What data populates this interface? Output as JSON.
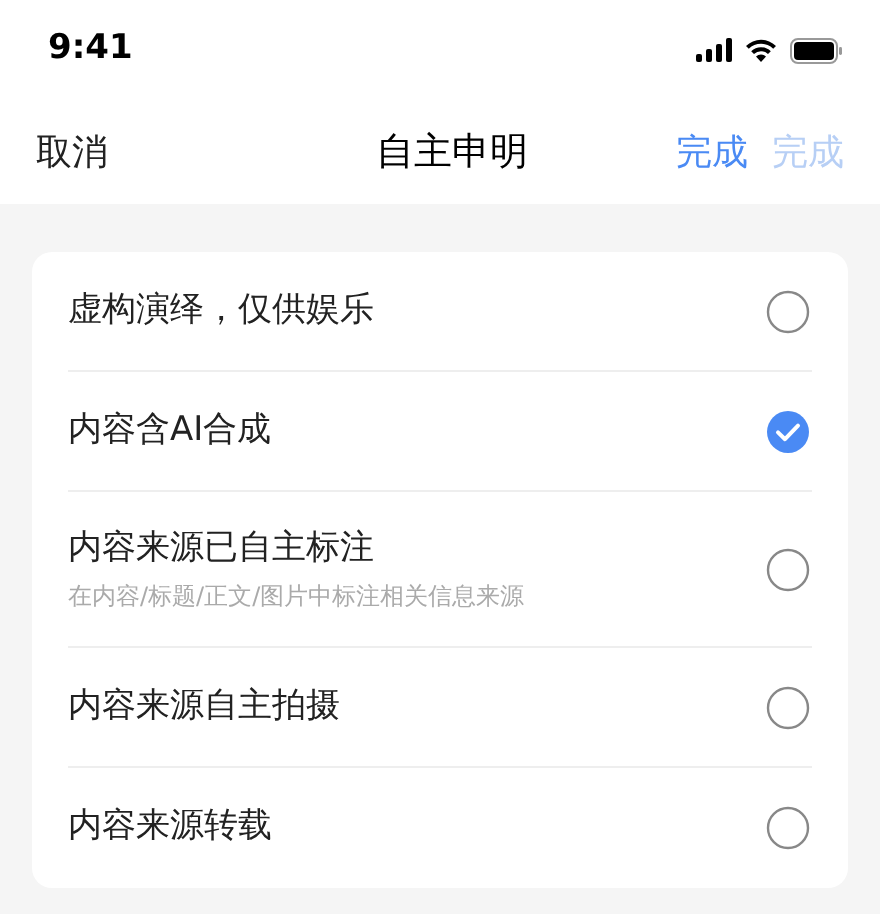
{
  "status_bar": {
    "time": "9:41"
  },
  "nav": {
    "cancel": "取消",
    "title": "自主申明",
    "actions": [
      {
        "label": "完成",
        "disabled": false
      },
      {
        "label": "完成",
        "disabled": true
      }
    ]
  },
  "options": [
    {
      "label": "虚构演绎，仅供娱乐",
      "selected": false
    },
    {
      "label": "内容含AI合成",
      "selected": true
    },
    {
      "label": "内容来源已自主标注",
      "hint": "在内容/标题/正文/图片中标注相关信息来源",
      "selected": false
    },
    {
      "label": "内容来源自主拍摄",
      "selected": false
    },
    {
      "label": "内容来源转载",
      "selected": false
    }
  ]
}
